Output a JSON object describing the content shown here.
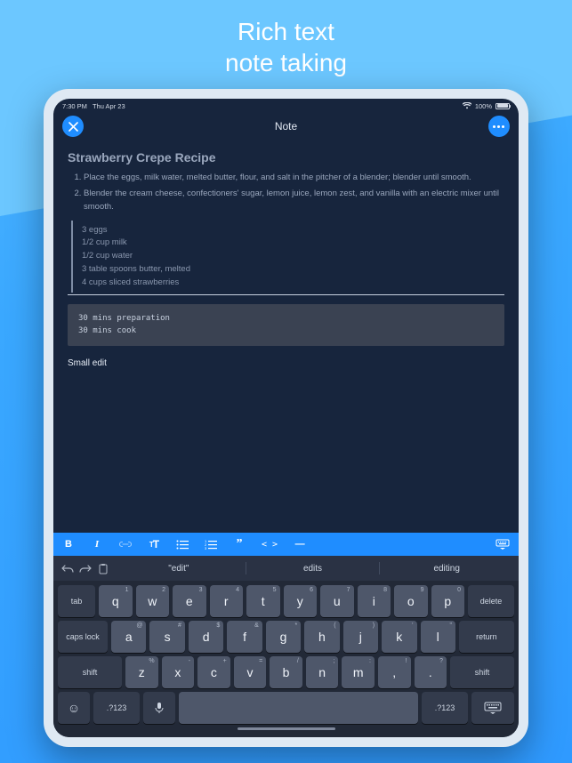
{
  "promo": {
    "line1": "Rich text",
    "line2": "note taking"
  },
  "status": {
    "time": "7:30 PM",
    "date": "Thu Apr 23",
    "battery_pct": "100%"
  },
  "nav": {
    "title": "Note"
  },
  "note": {
    "title": "Strawberry Crepe Recipe",
    "steps": [
      "Place the eggs, milk water, melted butter, flour, and salt in the pitcher of a blender; blender until smooth.",
      "Blender the cream cheese, confectioners' sugar, lemon juice, lemon zest, and vanilla with an electric mixer until smooth."
    ],
    "ingredients": [
      "3 eggs",
      "1/2 cup milk",
      "1/2 cup water",
      "3 table spoons butter, melted",
      "4 cups sliced strawberries"
    ],
    "code": "30 mins preparation\n30 mins cook",
    "trailing": "Small edit"
  },
  "format_toolbar": {
    "bold": "B",
    "italic": "I",
    "link": "link-icon",
    "textsize": "tT",
    "ul": "ul-icon",
    "ol": "ol-icon",
    "quote": "quote-icon",
    "code": "code-icon",
    "hr": "—",
    "dismiss": "kbd-dismiss-icon"
  },
  "suggestions": {
    "w1": "\"edit\"",
    "w2": "edits",
    "w3": "editing"
  },
  "keyboard": {
    "row1": [
      {
        "m": "q",
        "s": "1"
      },
      {
        "m": "w",
        "s": "2"
      },
      {
        "m": "e",
        "s": "3"
      },
      {
        "m": "r",
        "s": "4"
      },
      {
        "m": "t",
        "s": "5"
      },
      {
        "m": "y",
        "s": "6"
      },
      {
        "m": "u",
        "s": "7"
      },
      {
        "m": "i",
        "s": "8"
      },
      {
        "m": "o",
        "s": "9"
      },
      {
        "m": "p",
        "s": "0"
      }
    ],
    "row2": [
      {
        "m": "a",
        "s": "@"
      },
      {
        "m": "s",
        "s": "#"
      },
      {
        "m": "d",
        "s": "$"
      },
      {
        "m": "f",
        "s": "&"
      },
      {
        "m": "g",
        "s": "*"
      },
      {
        "m": "h",
        "s": "("
      },
      {
        "m": "j",
        "s": ")"
      },
      {
        "m": "k",
        "s": "'"
      },
      {
        "m": "l",
        "s": "\""
      }
    ],
    "row3": [
      {
        "m": "z",
        "s": "%"
      },
      {
        "m": "x",
        "s": "-"
      },
      {
        "m": "c",
        "s": "+"
      },
      {
        "m": "v",
        "s": "="
      },
      {
        "m": "b",
        "s": "/"
      },
      {
        "m": "n",
        "s": ";"
      },
      {
        "m": "m",
        "s": ":"
      },
      {
        "m": ",",
        "s": "!"
      },
      {
        "m": ".",
        "s": "?"
      }
    ],
    "tab": "tab",
    "delete": "delete",
    "caps": "caps lock",
    "return": "return",
    "shift": "shift",
    "sym": ".?123"
  }
}
